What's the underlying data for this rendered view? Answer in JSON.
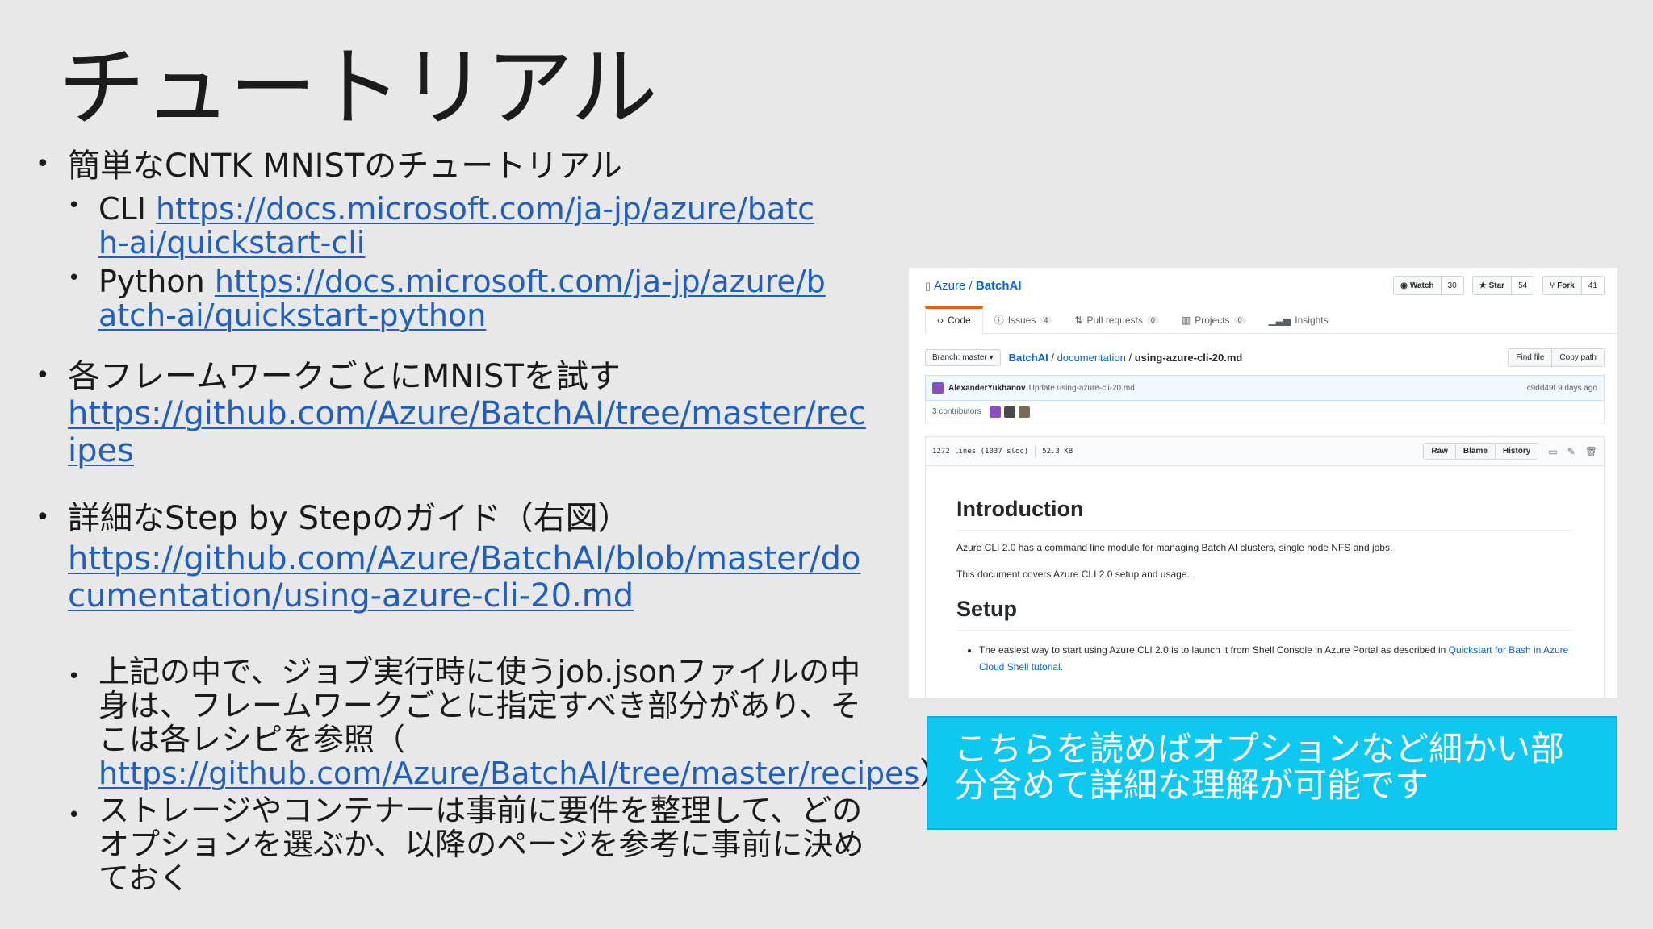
{
  "slide": {
    "title": "チュートリアル",
    "b1": {
      "text": "簡単なCNTK MNISTのチュートリアル"
    },
    "b1_1": {
      "label": "CLI ",
      "link": "https://docs.microsoft.com/ja-jp/azure/batch-ai/quickstart-cli"
    },
    "b1_2": {
      "label": "Python ",
      "link": "https://docs.microsoft.com/ja-jp/azure/batch-ai/quickstart-python"
    },
    "b2": {
      "text": "各フレームワークごとにMNISTを試す",
      "link": "https://github.com/Azure/BatchAI/tree/master/recipes"
    },
    "b3": {
      "text": "詳細なStep by Stepのガイド（右図）",
      "link": "https://github.com/Azure/BatchAI/blob/master/documentation/using-azure-cli-20.md"
    },
    "b3_1": {
      "text_before": "上記の中で、ジョブ実行時に使うjob.jsonファイルの中身は、フレームワークごとに指定すべき部分があり、そこは各レシピを参照（",
      "link": " https://github.com/Azure/BatchAI/tree/master/recipes",
      "text_after": "）"
    },
    "b3_2": {
      "text": "ストレージやコンテナーは事前に要件を整理して、どのオプションを選ぶか、以降のページを参考に事前に決めておく"
    },
    "bullet_glyph": "•",
    "callout": "こちらを読めばオプションなど細かい部分含めて詳細な理解が可能です"
  },
  "github": {
    "owner": "Azure",
    "repo": "BatchAI",
    "watch": {
      "label": "Watch",
      "count": "30"
    },
    "star": {
      "label": "Star",
      "count": "54"
    },
    "fork": {
      "label": "Fork",
      "count": "41"
    },
    "tabs": [
      {
        "label": "Code",
        "count": ""
      },
      {
        "label": "Issues",
        "count": "4"
      },
      {
        "label": "Pull requests",
        "count": "0"
      },
      {
        "label": "Projects",
        "count": "0"
      },
      {
        "label": "Insights",
        "count": ""
      }
    ],
    "branch": "Branch: master ▾",
    "breadcrumb": {
      "repo": "BatchAI",
      "folder": "documentation",
      "file": "using-azure-cli-20.md"
    },
    "find_file": "Find file",
    "copy_path": "Copy path",
    "commit": {
      "author": "AlexanderYukhanov",
      "message": "Update using-azure-cli-20.md",
      "meta": "c9dd49f 9 days ago"
    },
    "contributors": "3 contributors",
    "file_info": {
      "lines": "1272 lines (1037 sloc)",
      "size": "52.3 KB"
    },
    "file_buttons": {
      "raw": "Raw",
      "blame": "Blame",
      "history": "History"
    },
    "content": {
      "h_intro": "Introduction",
      "p1": "Azure CLI 2.0 has a command line module for managing Batch AI clusters, single node NFS and jobs.",
      "p2": "This document covers Azure CLI 2.0 setup and usage.",
      "h_setup": "Setup",
      "li_text": "The easiest way to start using Azure CLI 2.0 is to launch it from Shell Console in Azure Portal as described in ",
      "li_link": "Quickstart for Bash in Azure Cloud Shell tutorial",
      "li_end": "."
    }
  }
}
